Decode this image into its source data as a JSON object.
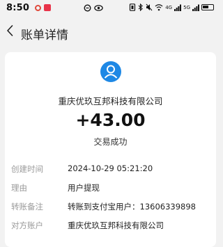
{
  "status_bar": {
    "time": "8:50",
    "signal_text_1": "4G",
    "signal_text_2": "5G"
  },
  "nav": {
    "title": "账单详情"
  },
  "bill": {
    "merchant": "重庆优玖互邦科技有限公司",
    "amount": "+43.00",
    "status": "交易成功",
    "details": [
      {
        "key": "创建时间",
        "value": "2024-10-29 05:21:20"
      },
      {
        "key": "理由",
        "value": "用户提现"
      },
      {
        "key": "转账备注",
        "value": "转账到支付宝用户：13606339898"
      },
      {
        "key": "对方账户",
        "value": "重庆优玖互邦科技有限公司"
      }
    ]
  },
  "colors": {
    "avatar": "#1e88e5",
    "background": "#f2f2f2"
  }
}
